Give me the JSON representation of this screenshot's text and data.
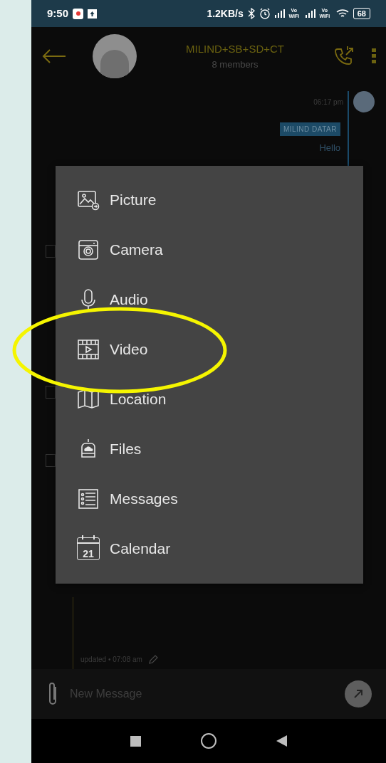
{
  "status_bar": {
    "time": "9:50",
    "speed": "1.2KB/s",
    "vo_labels": [
      "Vo WiFi",
      "Vo WiFi"
    ],
    "battery": "68"
  },
  "header": {
    "title": "MILIND+SB+SD+CT",
    "subtitle": "8 members"
  },
  "chat": {
    "time": "06:17 pm",
    "sender": "MILIND DATAR",
    "message": "Hello",
    "updated": "updated • 07:08 am",
    "checkboxes": [
      {
        "checked": false
      },
      {
        "checked": false
      },
      {
        "checked": false
      }
    ]
  },
  "attach_menu": {
    "items": [
      {
        "kind": "picture",
        "label": "Picture"
      },
      {
        "kind": "camera",
        "label": "Camera"
      },
      {
        "kind": "audio",
        "label": "Audio"
      },
      {
        "kind": "video",
        "label": "Video"
      },
      {
        "kind": "location",
        "label": "Location"
      },
      {
        "kind": "files",
        "label": "Files"
      },
      {
        "kind": "messages",
        "label": "Messages"
      },
      {
        "kind": "calendar",
        "label": "Calendar",
        "day": "21"
      }
    ]
  },
  "composer": {
    "placeholder": "New Message"
  }
}
